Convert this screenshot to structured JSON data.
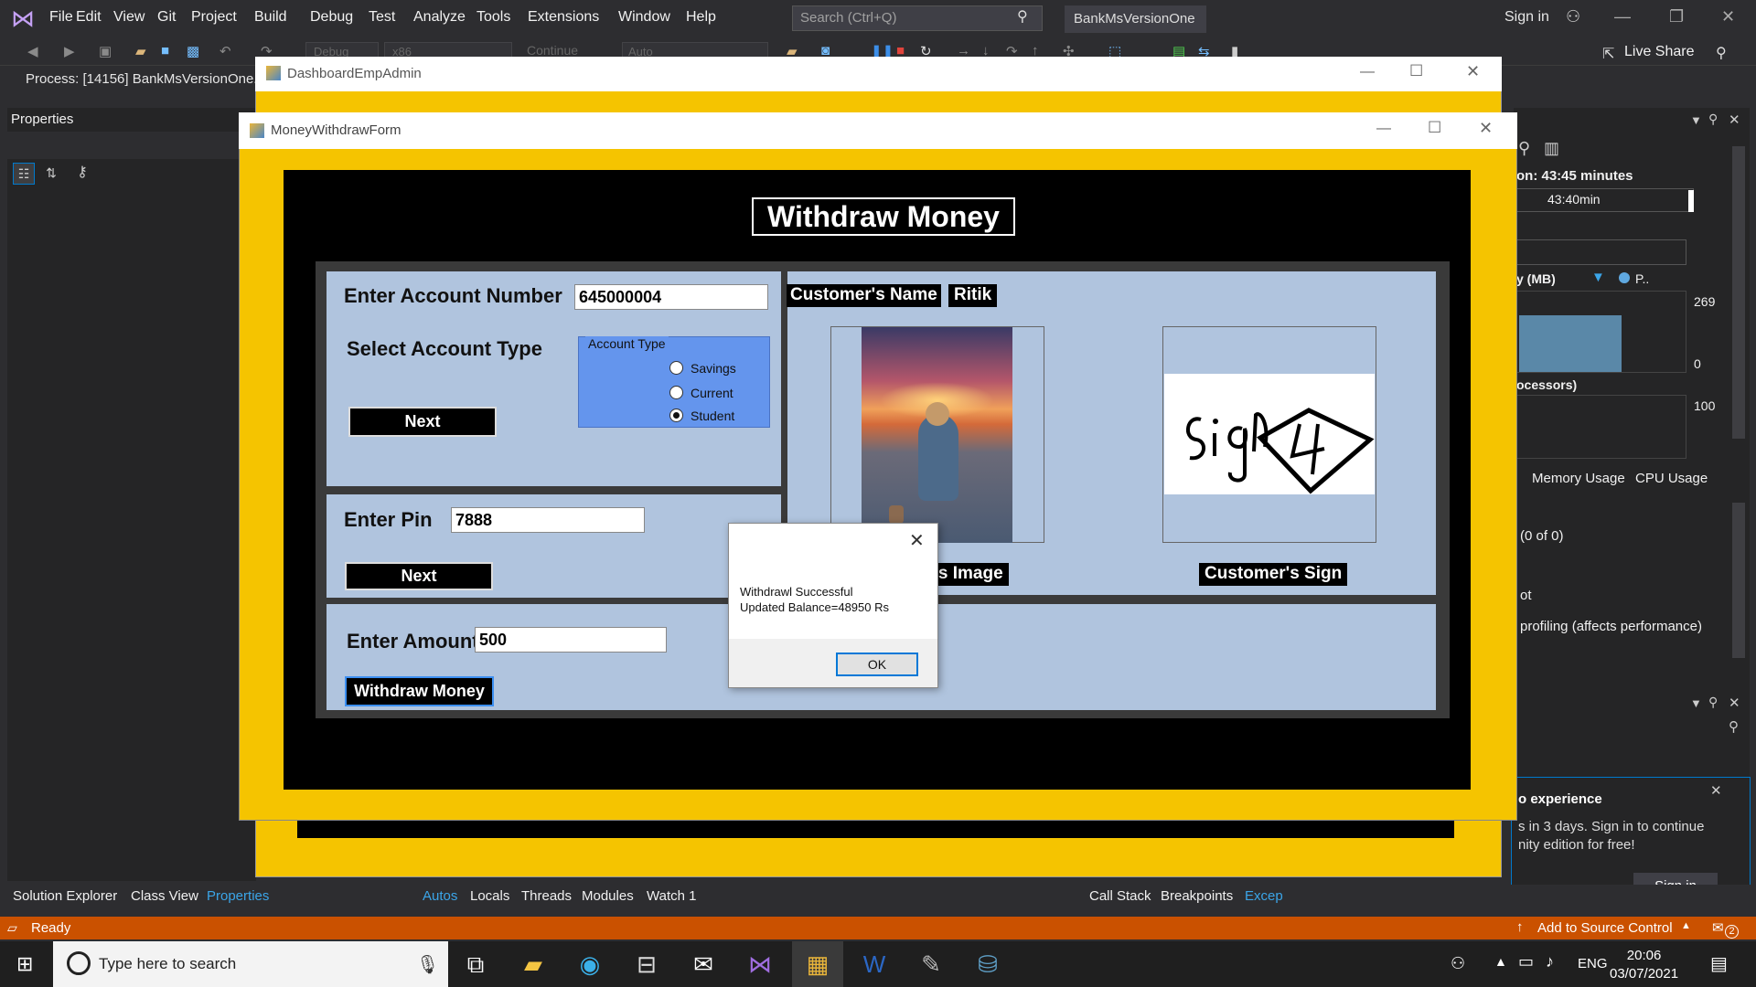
{
  "vs": {
    "menu": [
      "File",
      "Edit",
      "View",
      "Git",
      "Project",
      "Build",
      "Debug",
      "Test",
      "Analyze",
      "Tools",
      "Extensions",
      "Window",
      "Help"
    ],
    "search_placeholder": "Search (Ctrl+Q)",
    "solution_name": "BankMsVersionOne",
    "sign_in": "Sign in",
    "live_share": "Live Share",
    "toolbar": {
      "debug": "Debug",
      "platform": "x86",
      "continue": "Continue",
      "auto": "Auto"
    },
    "process": "Process:  [14156] BankMsVersionOne.e",
    "properties_title": "Properties",
    "diag": {
      "session": "on: 43:45 minutes",
      "time": "43:40min",
      "mem": "y (MB)",
      "legend": "P..",
      "v269": "269",
      "v0": "0",
      "proc": "ocessors)",
      "v100": "100",
      "tab_mem": "Memory Usage",
      "tab_cpu": "CPU Usage",
      "count": "(0 of 0)",
      "ot": "ot",
      "profiling": "profiling (affects performance)"
    },
    "popup": {
      "title": "o experience",
      "line1": "s in 3 days. Sign in to continue",
      "line2": "nity edition for free!",
      "button": "Sign in"
    },
    "bottom_tabs_left": [
      "Solution Explorer",
      "Class View",
      "Properties"
    ],
    "bottom_tabs_mid": [
      "Autos",
      "Locals",
      "Threads",
      "Modules",
      "Watch 1"
    ],
    "bottom_tabs_right": [
      "Call Stack",
      "Breakpoints",
      "Excep"
    ],
    "status": "Ready",
    "source_control": "Add to Source Control",
    "notifications": "2"
  },
  "dashboard": {
    "title": "DashboardEmpAdmin"
  },
  "form": {
    "title": "MoneyWithdrawForm",
    "header": "Withdraw Money",
    "account_number_label": "Enter Account Number",
    "account_number_value": "645000004",
    "account_type_label": "Select Account Type",
    "account_type_group": "Account Type",
    "account_types": [
      "Savings",
      "Current",
      "Student"
    ],
    "selected_account_type": "Student",
    "next1": "Next",
    "pin_label": "Enter Pin",
    "pin_value": "7888",
    "next2": "Next",
    "amount_label": "Enter Amount",
    "amount_value": "500",
    "withdraw_button": "Withdraw Money",
    "customer_name_label": "Customer's Name",
    "customer_name_value": "Ritik",
    "customer_image_label": "Customer's Image",
    "customer_image_visible": "r's Image",
    "customer_sign_label": "Customer's Sign"
  },
  "dialog": {
    "line1": "Withdrawl Successful",
    "line2": "Updated Balance=48950 Rs",
    "ok": "OK"
  },
  "taskbar": {
    "search_placeholder": "Type here to search",
    "lang": "ENG",
    "time": "20:06",
    "date": "03/07/2021"
  }
}
